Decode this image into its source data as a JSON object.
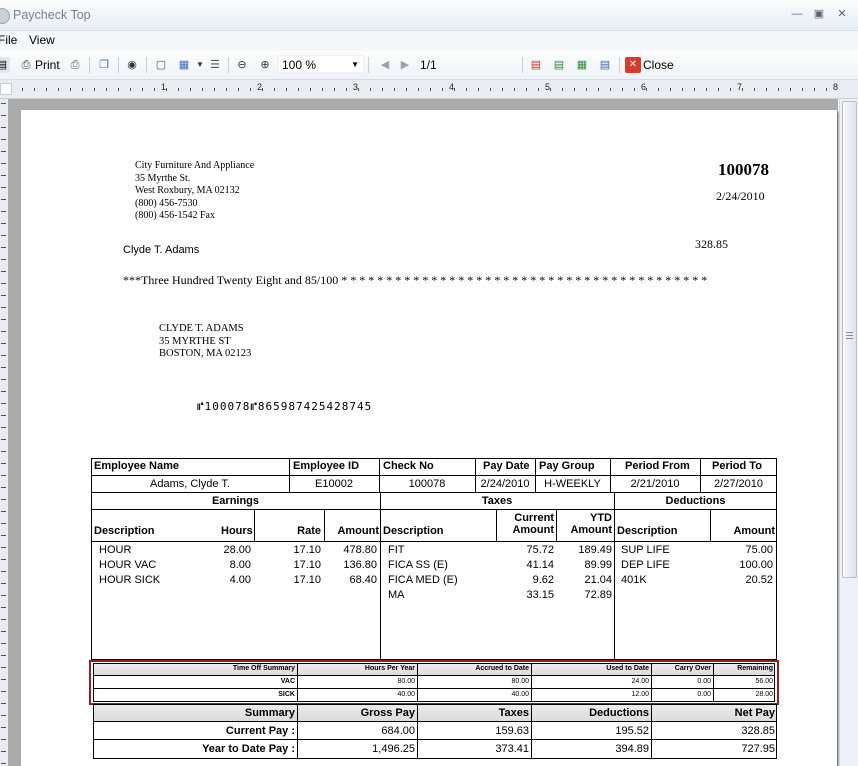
{
  "window": {
    "title": "Paycheck Top"
  },
  "menu": [
    "File",
    "View"
  ],
  "toolbar": {
    "print": "Print",
    "zoom": "100 %",
    "page": "1/1",
    "close": "Close"
  },
  "ruler": [
    "1",
    "2",
    "3",
    "4",
    "5",
    "6",
    "7",
    "8"
  ],
  "check": {
    "company": [
      "City Furniture And Appliance",
      "35 Myrthe St.",
      "West Roxbury, MA  02132",
      "(800) 456-7530",
      "(800) 456-1542 Fax"
    ],
    "number": "100078",
    "date": "2/24/2010",
    "payee": "Clyde T. Adams",
    "amount": "328.85",
    "amount_words": "***Three Hundred Twenty Eight and 85/100 * * * * * * * * * * * * * * * * * * * * * * * * * * * * * * * * * * * * * * * * *",
    "address": [
      "CLYDE T. ADAMS",
      "35 MYRTHE ST",
      "BOSTON, MA 02123"
    ],
    "micr": "⑈100078⑈865987425428745"
  },
  "stub": {
    "header_labels": [
      "Employee Name",
      "Employee ID",
      "Check No",
      "Pay Date",
      "Pay Group",
      "Period From",
      "Period To"
    ],
    "header_values": [
      "Adams, Clyde T.",
      "E10002",
      "100078",
      "2/24/2010",
      "H-WEEKLY",
      "2/21/2010",
      "2/27/2010"
    ],
    "earnings_title": "Earnings",
    "taxes_title": "Taxes",
    "deductions_title": "Deductions",
    "earnings_cols": [
      "Description",
      "Hours",
      "Rate",
      "Amount"
    ],
    "taxes_cols": [
      "Description",
      "Current Amount",
      "YTD Amount"
    ],
    "taxes_cols_split": [
      "Current",
      "Amount",
      "YTD",
      "Amount"
    ],
    "deductions_cols": [
      "Description",
      "Amount"
    ],
    "earnings": [
      {
        "desc": "HOUR",
        "hours": "28.00",
        "rate": "17.10",
        "amount": "478.80"
      },
      {
        "desc": "HOUR VAC",
        "hours": "8.00",
        "rate": "17.10",
        "amount": "136.80"
      },
      {
        "desc": "HOUR SICK",
        "hours": "4.00",
        "rate": "17.10",
        "amount": "68.40"
      }
    ],
    "taxes": [
      {
        "desc": "FIT",
        "current": "75.72",
        "ytd": "189.49"
      },
      {
        "desc": "FICA SS (E)",
        "current": "41.14",
        "ytd": "89.99"
      },
      {
        "desc": "FICA MED (E)",
        "current": "9.62",
        "ytd": "21.04"
      },
      {
        "desc": "MA",
        "current": "33.15",
        "ytd": "72.89"
      }
    ],
    "deductions": [
      {
        "desc": "SUP LIFE",
        "amount": "75.00"
      },
      {
        "desc": "DEP LIFE",
        "amount": "100.00"
      },
      {
        "desc": "401K",
        "amount": "20.52"
      }
    ],
    "timeoff_cols": [
      "Time Off  Summary",
      "Hours Per Year",
      "Accrued to Date",
      "Used to Date",
      "Carry Over",
      "Remaining"
    ],
    "timeoff": [
      [
        "VAC",
        "80.00",
        "80.00",
        "24.00",
        "0.00",
        "56.00"
      ],
      [
        "SICK",
        "40.00",
        "40.00",
        "12.00",
        "0.00",
        "28.00"
      ]
    ],
    "summary_cols": [
      "Summary",
      "Gross Pay",
      "Taxes",
      "Deductions",
      "Net Pay"
    ],
    "summary_rows": [
      [
        "Current Pay :",
        "684.00",
        "159.63",
        "195.52",
        "328.85"
      ],
      [
        "Year to Date Pay :",
        "1,496.25",
        "373.41",
        "394.89",
        "727.95"
      ]
    ]
  },
  "colors": {
    "highlight_border": "#9b1c1c",
    "accent": "#2f64b5"
  }
}
